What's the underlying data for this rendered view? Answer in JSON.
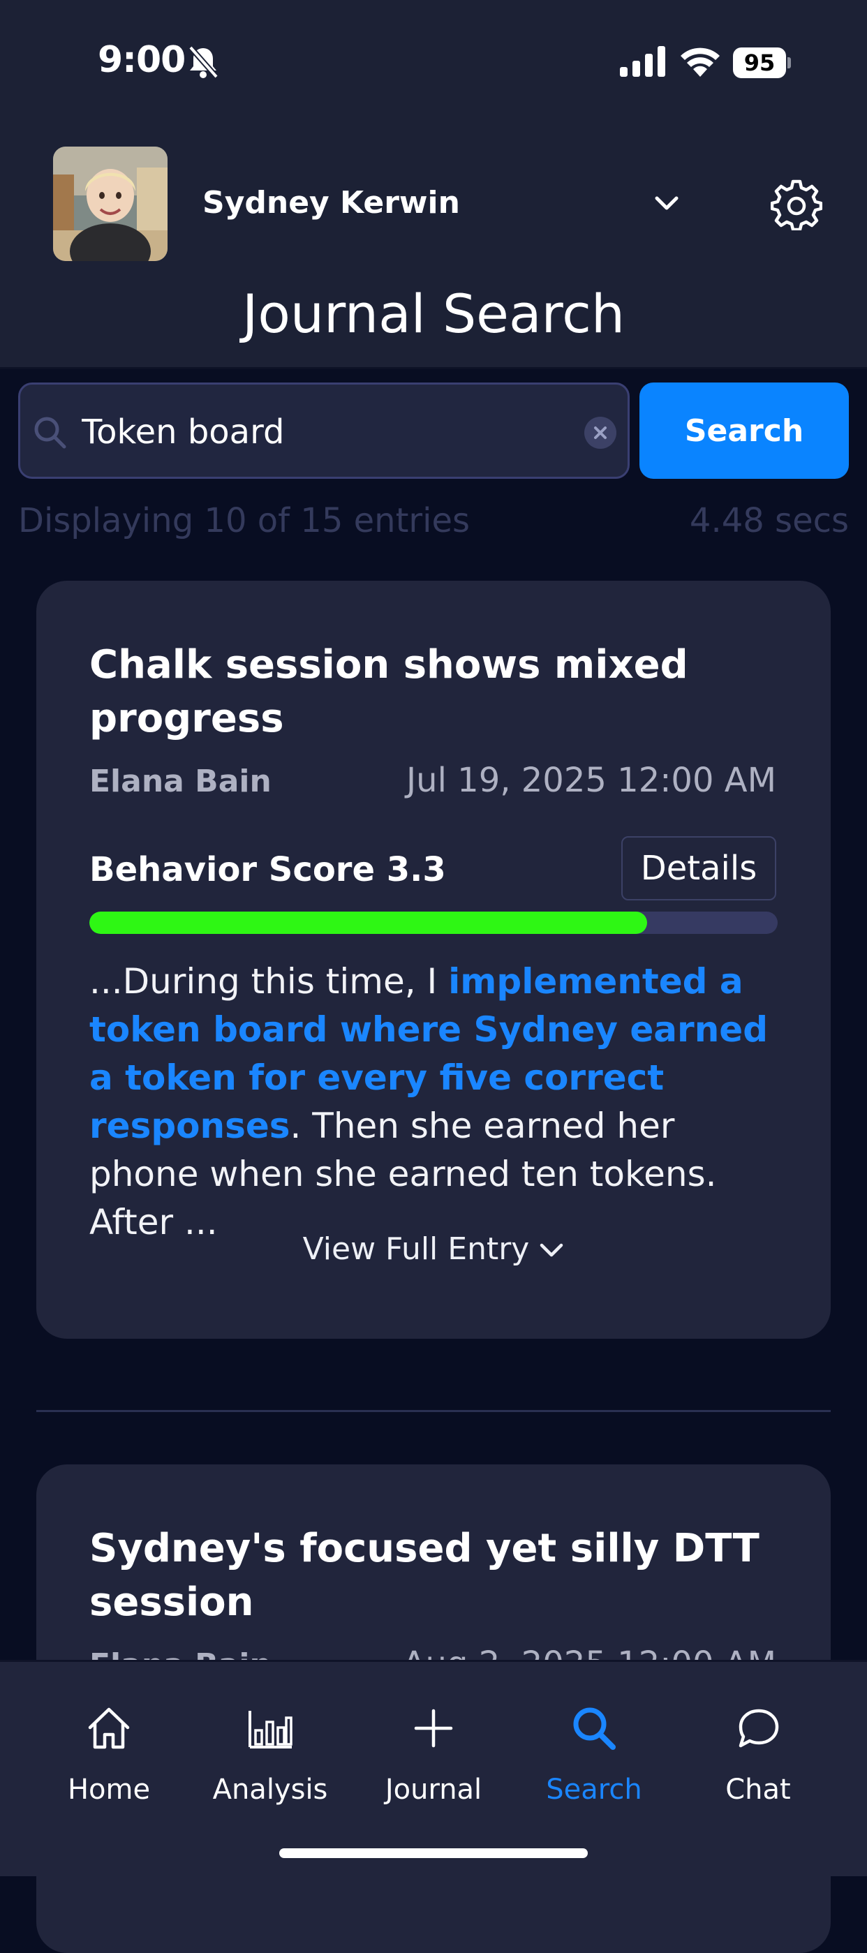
{
  "status_bar": {
    "time": "9:00",
    "battery": "95"
  },
  "header": {
    "user_name": "Sydney Kerwin",
    "page_title": "Journal Search"
  },
  "search": {
    "query": "Token board",
    "button_label": "Search",
    "results_text": "Displaying 10 of 15 entries",
    "elapsed": "4.48 secs"
  },
  "entries": [
    {
      "title": "Chalk session shows mixed progress",
      "author": "Elana Bain",
      "date": "Jul 19, 2025 12:00 AM",
      "score_label": "Behavior Score  3.3",
      "score_fraction": 0.81,
      "details_label": "Details",
      "excerpt_before": "...During this time, I ",
      "excerpt_highlight": "implemented a token board where Sydney earned a token for every five correct responses",
      "excerpt_after": ". Then she earned her phone when she earned ten tokens. After ...",
      "view_full_label": "View Full Entry"
    },
    {
      "title": "Sydney's focused yet silly DTT session",
      "author": "Elana Bain",
      "date": "Aug 2, 2025 12:00 AM"
    }
  ],
  "tabs": [
    {
      "label": "Home",
      "icon": "home-icon"
    },
    {
      "label": "Analysis",
      "icon": "bar-chart-icon"
    },
    {
      "label": "Journal",
      "icon": "plus-icon"
    },
    {
      "label": "Search",
      "icon": "search-icon",
      "active": true
    },
    {
      "label": "Chat",
      "icon": "chat-bubble-icon"
    }
  ],
  "colors": {
    "accent": "#0a84ff",
    "score_bar": "#2ef714",
    "background": "#080d22",
    "card": "#21253c"
  }
}
